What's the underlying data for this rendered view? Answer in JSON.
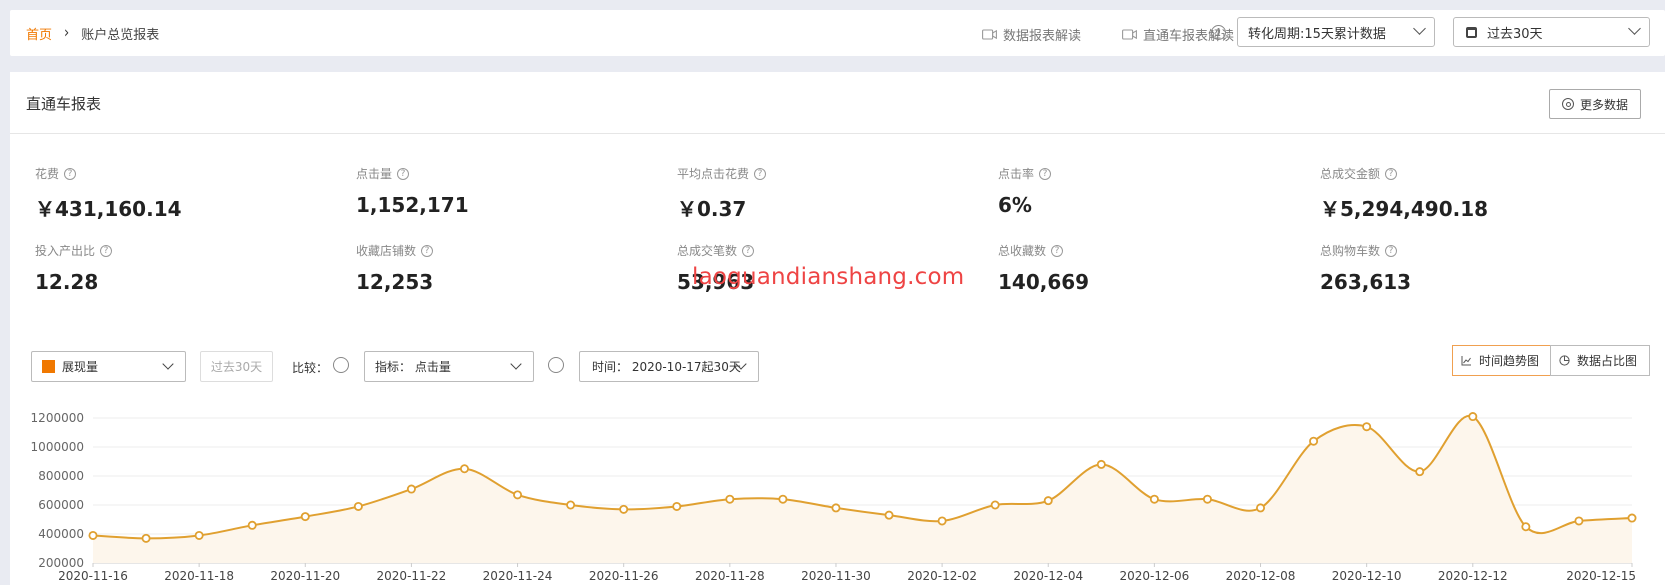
{
  "topbar": {
    "breadcrumb_home": "首页",
    "breadcrumb_sep": "›",
    "breadcrumb_current": "账户总览报表",
    "explain_data_report": "数据报表解读",
    "explain_ztc_report": "直通车报表解读",
    "conversion_period": "转化周期:15天累计数据",
    "date_range": "过去30天"
  },
  "report": {
    "title": "直通车报表",
    "more_data_label": "更多数据",
    "metrics": [
      {
        "label": "花费",
        "value": "￥431,160.14"
      },
      {
        "label": "点击量",
        "value": "1,152,171"
      },
      {
        "label": "平均点击花费",
        "value": "￥0.37"
      },
      {
        "label": "点击率",
        "value": "6%"
      },
      {
        "label": "总成交金额",
        "value": "￥5,294,490.18"
      },
      {
        "label": "投入产出比",
        "value": "12.28"
      },
      {
        "label": "收藏店铺数",
        "value": "12,253"
      },
      {
        "label": "总成交笔数",
        "value": "53,963"
      },
      {
        "label": "总收藏数",
        "value": "140,669"
      },
      {
        "label": "总购物车数",
        "value": "263,613"
      }
    ]
  },
  "watermark": "laoguandianshang.com",
  "controls": {
    "metric_select": "展现量",
    "past_30": "过去30天",
    "compare_label": "比较：",
    "indicator_select": "指标： 点击量",
    "time_select": "时间： 2020-10-17起30天",
    "trend_button": "时间趋势图",
    "share_button": "数据占比图"
  },
  "colors": {
    "accent": "#f07800",
    "line": "#e0a030",
    "fill": "#fdf6ec"
  },
  "chart_data": {
    "type": "area",
    "x": [
      "2020-11-16",
      "2020-11-17",
      "2020-11-18",
      "2020-11-19",
      "2020-11-20",
      "2020-11-21",
      "2020-11-22",
      "2020-11-23",
      "2020-11-24",
      "2020-11-25",
      "2020-11-26",
      "2020-11-27",
      "2020-11-28",
      "2020-11-29",
      "2020-11-30",
      "2020-12-01",
      "2020-12-02",
      "2020-12-03",
      "2020-12-04",
      "2020-12-05",
      "2020-12-06",
      "2020-12-07",
      "2020-12-08",
      "2020-12-09",
      "2020-12-10",
      "2020-12-11",
      "2020-12-12",
      "2020-12-13",
      "2020-12-14",
      "2020-12-15"
    ],
    "x_tick_labels": [
      "2020-11-16",
      "2020-11-18",
      "2020-11-20",
      "2020-11-22",
      "2020-11-24",
      "2020-11-26",
      "2020-11-28",
      "2020-11-30",
      "2020-12-02",
      "2020-12-04",
      "2020-12-06",
      "2020-12-08",
      "2020-12-10",
      "2020-12-12",
      "2020-12-15"
    ],
    "series": [
      {
        "values": [
          390000,
          370000,
          390000,
          460000,
          520000,
          590000,
          710000,
          850000,
          670000,
          600000,
          570000,
          590000,
          640000,
          640000,
          580000,
          530000,
          490000,
          600000,
          630000,
          880000,
          640000,
          640000,
          580000,
          1040000,
          1140000,
          830000,
          1210000,
          450000,
          490000,
          510000
        ]
      }
    ],
    "y_ticks": [
      "1200000",
      "1000000",
      "800000",
      "600000",
      "400000",
      "200000"
    ],
    "ylim": [
      200000,
      1200000
    ],
    "grid": true
  }
}
